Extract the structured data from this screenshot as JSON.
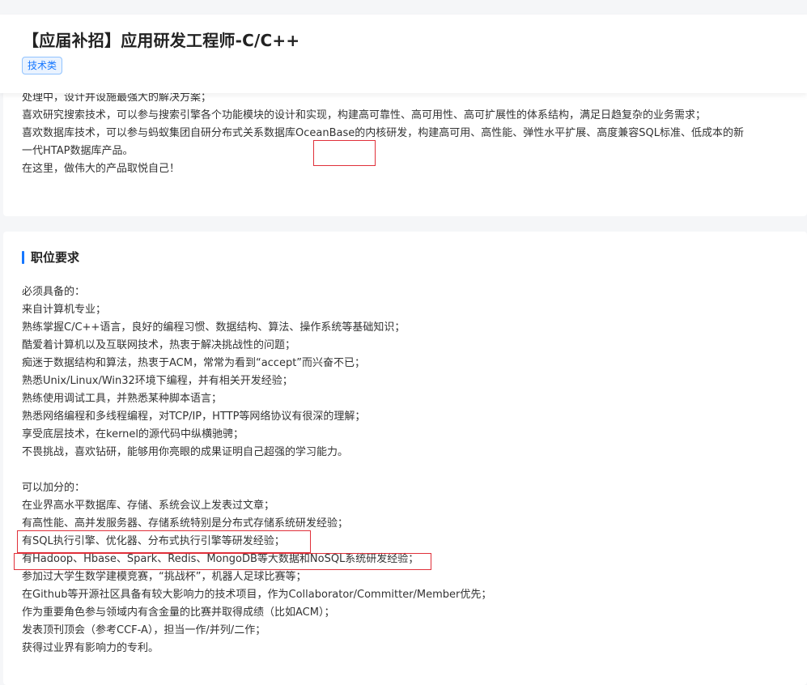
{
  "header": {
    "title": "【应届补招】应用研发工程师-C/C++",
    "tag": "技术类"
  },
  "description": {
    "lines": [
      "处理中，设计并设施最强大的解决方案；",
      "喜欢研究搜索技术，可以参与搜索引擎各个功能模块的设计和实现，构建高可靠性、高可用性、高可扩展性的体系结构，满足日趋复杂的业务需求；",
      "喜欢数据库技术，可以参与蚂蚁集团自研分布式关系数据库OceanBase的内核研发，构建高可用、高性能、弹性水平扩展、高度兼容SQL标准、低成本的新一代HTAP数据库产品。",
      "在这里，做伟大的产品取悦自己！"
    ]
  },
  "requirements": {
    "section_title": "职位要求",
    "required": [
      "必须具备的：",
      "来自计算机专业；",
      "熟练掌握C/C++语言，良好的编程习惯、数据结构、算法、操作系统等基础知识；",
      "酷爱着计算机以及互联网技术，热衷于解决挑战性的问题；",
      "痴迷于数据结构和算法，热衷于ACM，常常为看到“accept”而兴奋不已；",
      "熟悉Unix/Linux/Win32环境下编程，并有相关开发经验；",
      "熟练使用调试工具，并熟悉某种脚本语言；",
      "熟悉网络编程和多线程编程，对TCP/IP，HTTP等网络协议有很深的理解；",
      "享受底层技术，在kernel的源代码中纵横驰骋；",
      "不畏挑战，喜欢钻研，能够用你亮眼的成果证明自己超强的学习能力。"
    ],
    "bonus": [
      "可以加分的：",
      "在业界高水平数据库、存储、系统会议上发表过文章；",
      "有高性能、高并发服务器、存储系统特别是分布式存储系统研发经验；",
      "有SQL执行引擎、优化器、分布式执行引擎等研发经验；",
      "有Hadoop、Hbase、Spark、Redis、MongoDB等大数据和NoSQL系统研发经验；",
      "参加过大学生数学建模竞赛，“挑战杯”，机器人足球比赛等；",
      "在Github等开源社区具备有较大影响力的技术项目，作为Collaborator/Committer/Member优先；",
      "作为重要角色参与领域内有含金量的比赛并取得成绩（比如ACM）；",
      "发表顶刊顶会（参考CCF-A），担当一作/并列/二作；",
      "获得过业界有影响力的专利。"
    ]
  },
  "colors": {
    "accent": "#1677ff",
    "highlight": "#e0303a"
  }
}
